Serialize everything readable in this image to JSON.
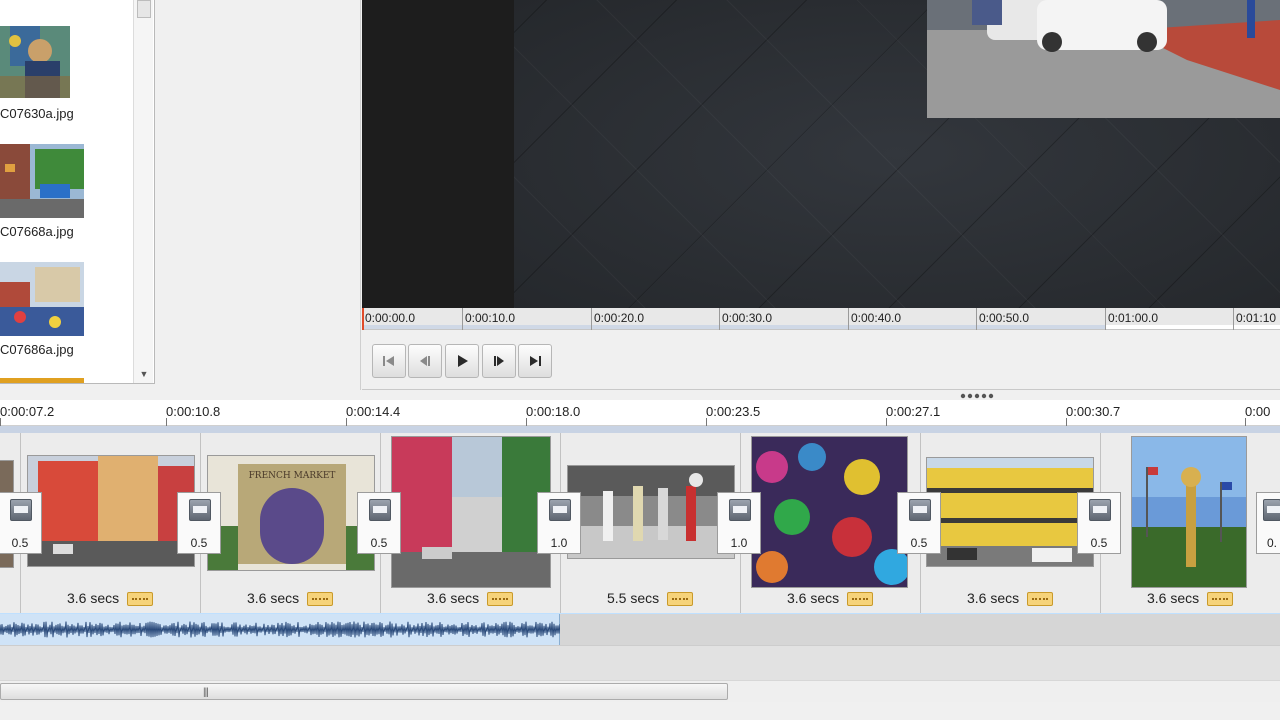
{
  "files": [
    {
      "name": ""
    },
    {
      "name": "C07630a.jpg"
    },
    {
      "name": "C07668a.jpg"
    },
    {
      "name": "C07686a.jpg"
    }
  ],
  "preview_ruler": [
    "0:00:00.0",
    "0:00:10.0",
    "0:00:20.0",
    "0:00:30.0",
    "0:00:40.0",
    "0:00:50.0",
    "0:01:00.0",
    "0:01:10"
  ],
  "timeline_ruler": [
    "0:00:07.2",
    "0:00:10.8",
    "0:00:14.4",
    "0:00:18.0",
    "0:00:23.5",
    "0:00:27.1",
    "0:00:30.7",
    "0:00"
  ],
  "clips": [
    {
      "duration": "3.6 secs"
    },
    {
      "duration": "3.6 secs"
    },
    {
      "duration": "3.6 secs"
    },
    {
      "duration": "5.5 secs"
    },
    {
      "duration": "3.6 secs"
    },
    {
      "duration": "3.6 secs"
    },
    {
      "duration": "3.6 secs"
    }
  ],
  "transitions": [
    "0.5",
    "0.5",
    "0.5",
    "1.0",
    "1.0",
    "0.5",
    "0.5",
    "0."
  ],
  "clip_sign": "FRENCH MARKET",
  "colors": {
    "accent": "#c8d3e4",
    "playhead": "#e04b2a",
    "badge": "#f6d37a"
  }
}
